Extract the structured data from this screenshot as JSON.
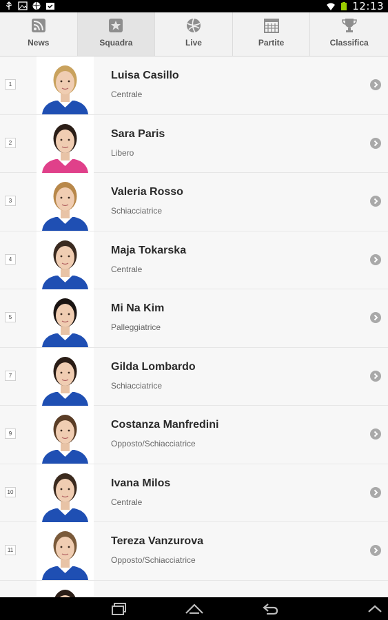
{
  "status_bar": {
    "time": "12:13"
  },
  "tabs": [
    {
      "label": "News",
      "icon": "rss-icon",
      "active": false
    },
    {
      "label": "Squadra",
      "icon": "star-icon",
      "active": true
    },
    {
      "label": "Live",
      "icon": "volleyball-icon",
      "active": false
    },
    {
      "label": "Partite",
      "icon": "calendar-icon",
      "active": false
    },
    {
      "label": "Classifica",
      "icon": "trophy-icon",
      "active": false
    }
  ],
  "players": [
    {
      "number": "1",
      "name": "Luisa Casillo",
      "role": "Centrale",
      "hair": "#c9a25e",
      "shirt": "#1f4fb3"
    },
    {
      "number": "2",
      "name": "Sara Paris",
      "role": "Libero",
      "hair": "#2b1e17",
      "shirt": "#e0408a"
    },
    {
      "number": "3",
      "name": "Valeria Rosso",
      "role": "Schiacciatrice",
      "hair": "#b8884a",
      "shirt": "#1f4fb3"
    },
    {
      "number": "4",
      "name": "Maja Tokarska",
      "role": "Centrale",
      "hair": "#3a2a20",
      "shirt": "#1f4fb3"
    },
    {
      "number": "5",
      "name": "Mi Na Kim",
      "role": "Palleggiatrice",
      "hair": "#1a1412",
      "shirt": "#1f4fb3"
    },
    {
      "number": "7",
      "name": "Gilda Lombardo",
      "role": "Schiacciatrice",
      "hair": "#2a1d16",
      "shirt": "#1f4fb3"
    },
    {
      "number": "9",
      "name": "Costanza Manfredini",
      "role": "Opposto/Schiacciatrice",
      "hair": "#5a3d26",
      "shirt": "#1f4fb3"
    },
    {
      "number": "10",
      "name": "Ivana Milos",
      "role": "Centrale",
      "hair": "#3b2a1e",
      "shirt": "#1f4fb3"
    },
    {
      "number": "11",
      "name": "Tereza Vanzurova",
      "role": "Opposto/Schiacciatrice",
      "hair": "#7a5a3a",
      "shirt": "#1f4fb3"
    },
    {
      "number": "",
      "name": "",
      "role": "",
      "hair": "#2a1d16",
      "shirt": "#1f4fb3"
    }
  ]
}
